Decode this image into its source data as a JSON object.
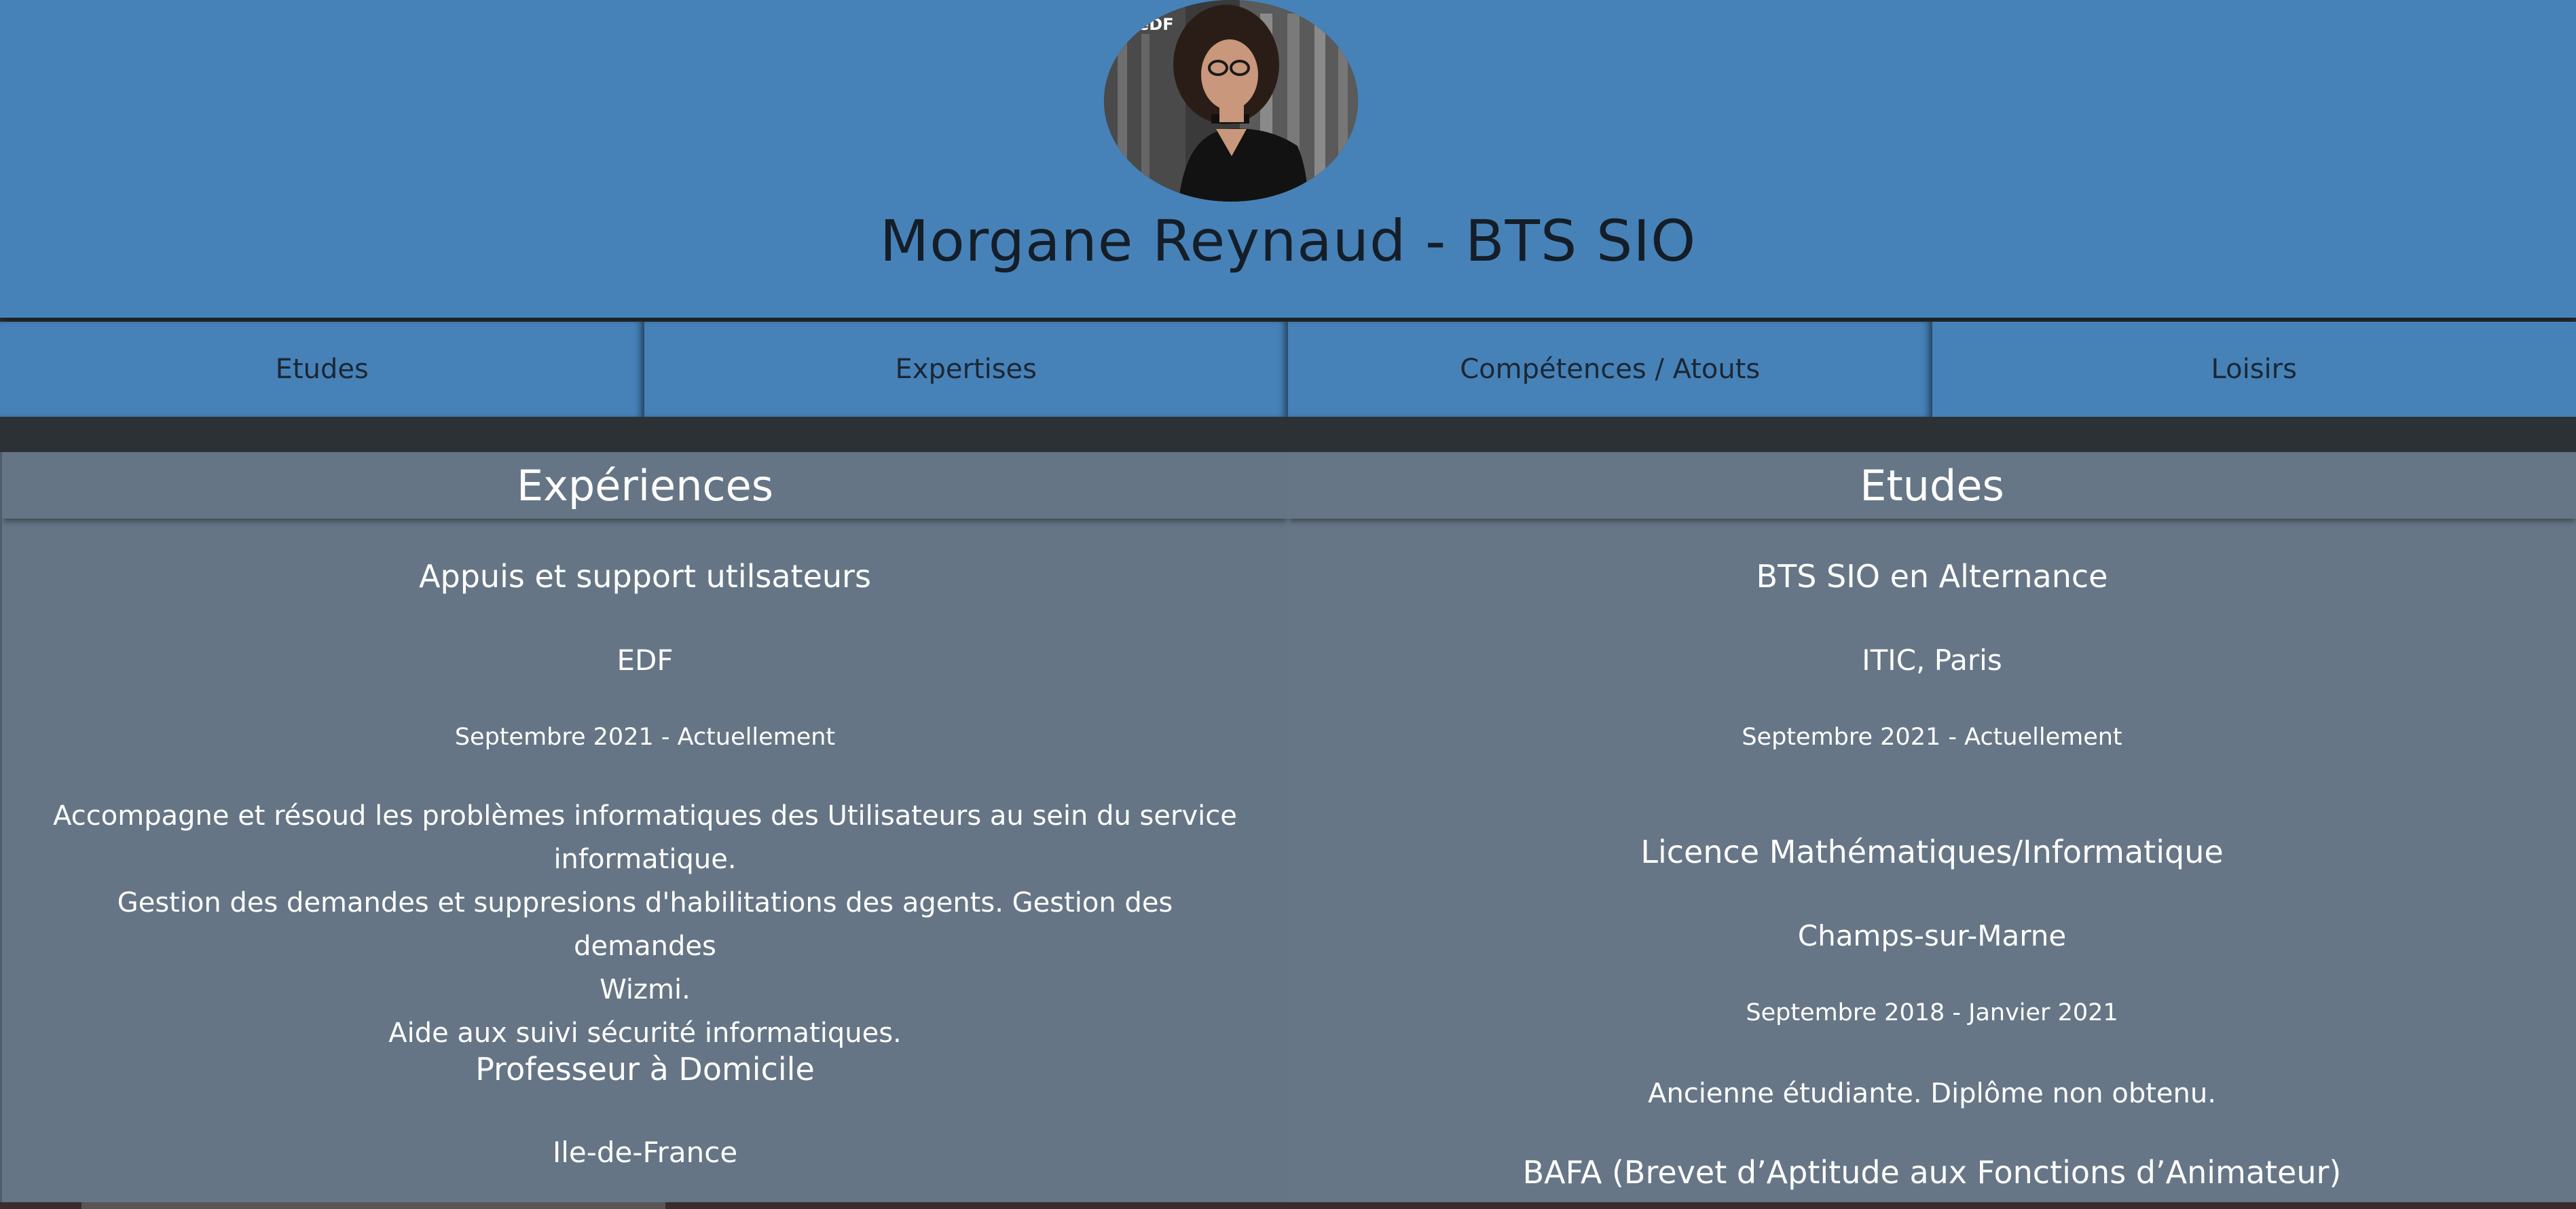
{
  "header": {
    "title": "Morgane Reynaud - BTS SIO",
    "avatar_badge": "eDF"
  },
  "nav": {
    "items": [
      "Etudes",
      "Expertises",
      "Compétences / Atouts",
      "Loisirs"
    ]
  },
  "experiences": {
    "heading": "Expériences",
    "entries": [
      {
        "title": "Appuis et support utilsateurs",
        "place": "EDF",
        "date": "Septembre 2021 - Actuellement",
        "desc_lines": [
          "Accompagne et résoud les problèmes informatiques des Utilisateurs au sein du service",
          "informatique.",
          "Gestion des demandes et suppresions d'habilitations des agents. Gestion des demandes",
          "Wizmi.",
          "Aide aux suivi sécurité informatiques."
        ]
      },
      {
        "title": "Professeur à Domicile",
        "place": "Ile-de-France"
      }
    ]
  },
  "etudes": {
    "heading": "Etudes",
    "entries": [
      {
        "title": "BTS SIO en Alternance",
        "place": "ITIC, Paris",
        "date": "Septembre 2021 - Actuellement"
      },
      {
        "title": "Licence Mathématiques/Informatique",
        "place": "Champs-sur-Marne",
        "date": "Septembre 2018 - Janvier 2021",
        "desc": "Ancienne étudiante. Diplôme non obtenu."
      },
      {
        "title": "BAFA (Brevet d’Aptitude aux Fonctions d’Animateur)"
      }
    ]
  },
  "colors": {
    "header_bg": "#4682b8",
    "content_bg": "#657585",
    "title_text": "#151e28",
    "body_text": "#ffffff"
  }
}
